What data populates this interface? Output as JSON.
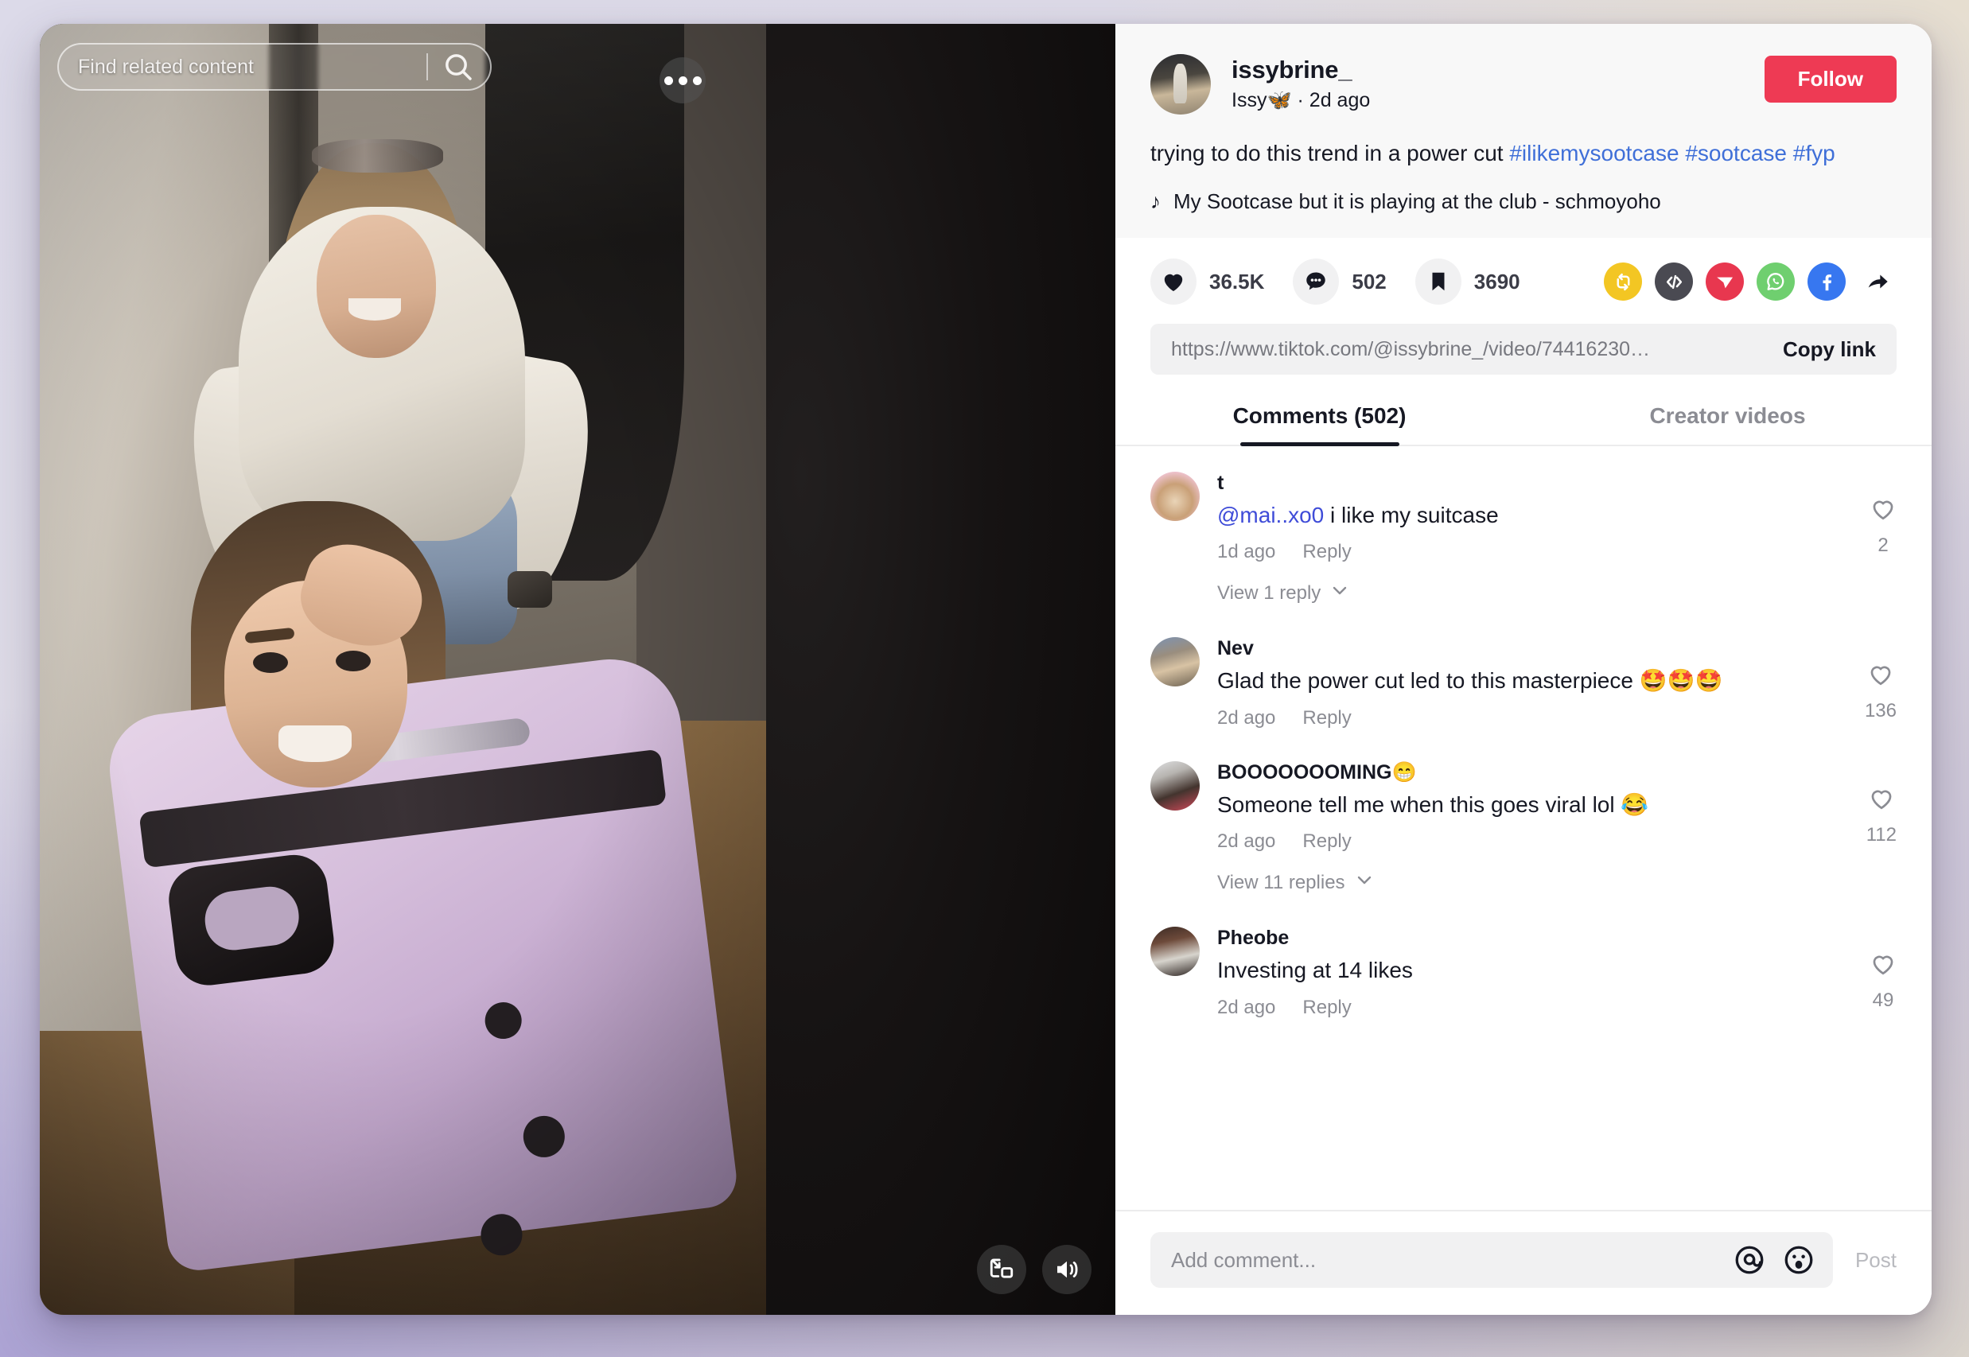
{
  "video": {
    "search_placeholder": "Find related content",
    "search_icon": "search-icon",
    "more_options_icon": "ellipsis-icon",
    "pip_icon": "picture-in-picture-icon",
    "volume_icon": "volume-on-icon"
  },
  "post": {
    "author_handle": "issybrine_",
    "author_display": "Issy🦋 · 2d ago",
    "follow_label": "Follow",
    "caption_text": "trying to do this trend in a power cut ",
    "caption_tags": [
      "#ilikemysootcase",
      "#sootcase",
      "#fyp"
    ],
    "music_note_icon": "music-note-icon",
    "music_title": "My Sootcase but it is playing at the club - schmoyoho",
    "accent_color": "#ee3a54",
    "link_color": "#3f6fd8"
  },
  "actions": {
    "like": {
      "icon": "heart-icon",
      "count": "36.5K"
    },
    "comment": {
      "icon": "comment-icon",
      "count": "502"
    },
    "bookmark": {
      "icon": "bookmark-icon",
      "count": "3690"
    },
    "share_targets": [
      {
        "name": "repost-icon",
        "color": "#f3c623"
      },
      {
        "name": "embed-code-icon",
        "color": "#4a4a52"
      },
      {
        "name": "telegram-icon",
        "color": "#e8374f"
      },
      {
        "name": "whatsapp-icon",
        "color": "#6fcf6f"
      },
      {
        "name": "facebook-icon",
        "color": "#3777f0"
      },
      {
        "name": "share-arrow-icon",
        "color": "#161823"
      }
    ]
  },
  "link": {
    "url": "https://www.tiktok.com/@issybrine_/video/74416230…",
    "copy_label": "Copy link"
  },
  "tabs": [
    {
      "label": "Comments (502)",
      "active": true
    },
    {
      "label": "Creator videos",
      "active": false
    }
  ],
  "comments": [
    {
      "avatar": "av-pig",
      "name": "t",
      "mention": "@mai..xo0",
      "text": " i like my suitcase",
      "time": "1d ago",
      "reply_label": "Reply",
      "likes": "2",
      "replies_label": "View 1 reply"
    },
    {
      "avatar": "av-nev",
      "name": "Nev",
      "mention": "",
      "text": "Glad the power cut led to this masterpiece 🤩🤩🤩",
      "time": "2d ago",
      "reply_label": "Reply",
      "likes": "136",
      "replies_label": ""
    },
    {
      "avatar": "av-boom",
      "name": "BOOOOOOOMING😁",
      "mention": "",
      "text": "Someone tell me when this goes viral lol 😂",
      "time": "2d ago",
      "reply_label": "Reply",
      "likes": "112",
      "replies_label": "View 11 replies"
    },
    {
      "avatar": "av-pheobe",
      "name": "Pheobe",
      "mention": "",
      "text": "Investing at 14 likes",
      "time": "2d ago",
      "reply_label": "Reply",
      "likes": "49",
      "replies_label": ""
    }
  ],
  "composer": {
    "placeholder": "Add comment...",
    "mention_icon": "at-mention-icon",
    "emoji_icon": "emoji-icon",
    "post_label": "Post"
  }
}
